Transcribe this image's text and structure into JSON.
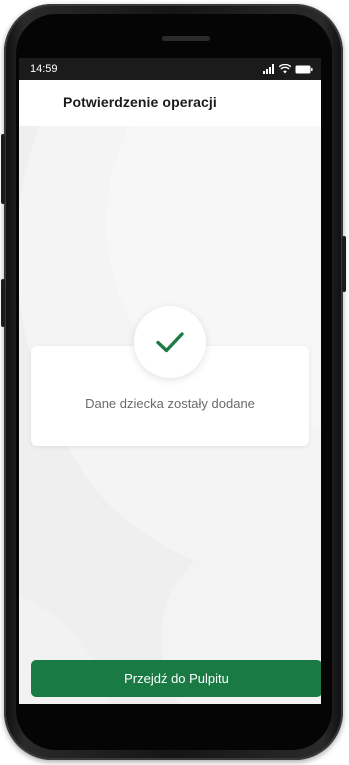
{
  "status_bar": {
    "time": "14:59",
    "signal_icon": "signal-bars-icon",
    "wifi_icon": "wifi-icon",
    "battery_icon": "battery-icon"
  },
  "header": {
    "title": "Potwierdzenie operacji"
  },
  "confirmation": {
    "icon": "checkmark-icon",
    "message": "Dane dziecka zostały dodane"
  },
  "actions": {
    "primary_label": "Przejdź do Pulpitu"
  },
  "colors": {
    "accent_green": "#1a7a43",
    "check_green": "#1e7a46"
  }
}
